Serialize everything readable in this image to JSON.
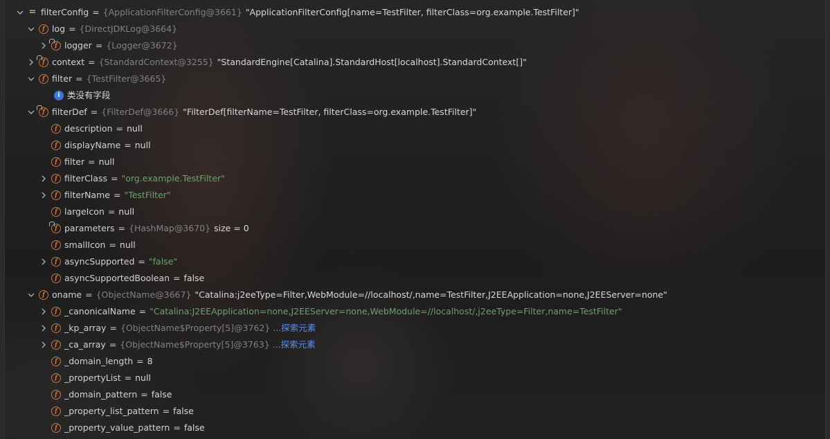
{
  "rows": [
    {
      "name": "filterConfig",
      "ref": "{ApplicationFilterConfig@3661}",
      "value": "\"ApplicationFilterConfig[name=TestFilter, filterClass=org.example.TestFilter]\""
    },
    {
      "name": "log",
      "ref": "{DirectJDKLog@3664}"
    },
    {
      "name": "logger",
      "ref": "{Logger@3672}"
    },
    {
      "name": "context",
      "ref": "{StandardContext@3255}",
      "value": "\"StandardEngine[Catalina].StandardHost[localhost].StandardContext[]\""
    },
    {
      "name": "filter",
      "ref": "{TestFilter@3665}"
    },
    {
      "text": "类没有字段"
    },
    {
      "name": "filterDef",
      "ref": "{FilterDef@3666}",
      "value": "\"FilterDef[filterName=TestFilter, filterClass=org.example.TestFilter]\""
    },
    {
      "name": "description",
      "plain": "null"
    },
    {
      "name": "displayName",
      "plain": "null"
    },
    {
      "name": "filter",
      "plain": "null"
    },
    {
      "name": "filterClass",
      "str": "\"org.example.TestFilter\""
    },
    {
      "name": "filterName",
      "str": "\"TestFilter\""
    },
    {
      "name": "largeIcon",
      "plain": "null"
    },
    {
      "name": "parameters",
      "ref": "{HashMap@3670}",
      "extra": "size = 0"
    },
    {
      "name": "smallIcon",
      "plain": "null"
    },
    {
      "name": "asyncSupported",
      "str": "\"false\""
    },
    {
      "name": "asyncSupportedBoolean",
      "plain": "false"
    },
    {
      "name": "oname",
      "ref": "{ObjectName@3667}",
      "value": "\"Catalina:j2eeType=Filter,WebModule=//localhost/,name=TestFilter,J2EEApplication=none,J2EEServer=none\""
    },
    {
      "name": "_canonicalName",
      "str": "\"Catalina:J2EEApplication=none,J2EEServer=none,WebModule=//localhost/,j2eeType=Filter,name=TestFilter\""
    },
    {
      "name": "_kp_array",
      "ref": "{ObjectName$Property[5]@3762}",
      "link": "...探索元素"
    },
    {
      "name": "_ca_array",
      "ref": "{ObjectName$Property[5]@3763}",
      "link": "...探索元素"
    },
    {
      "name": "_domain_length",
      "plain": "8"
    },
    {
      "name": "_propertyList",
      "plain": "null"
    },
    {
      "name": "_domain_pattern",
      "plain": "false"
    },
    {
      "name": "_property_list_pattern",
      "plain": "false"
    },
    {
      "name": "_property_value_pattern",
      "plain": "false"
    }
  ],
  "icons": {
    "field": "f",
    "info": "i",
    "equals": "="
  }
}
